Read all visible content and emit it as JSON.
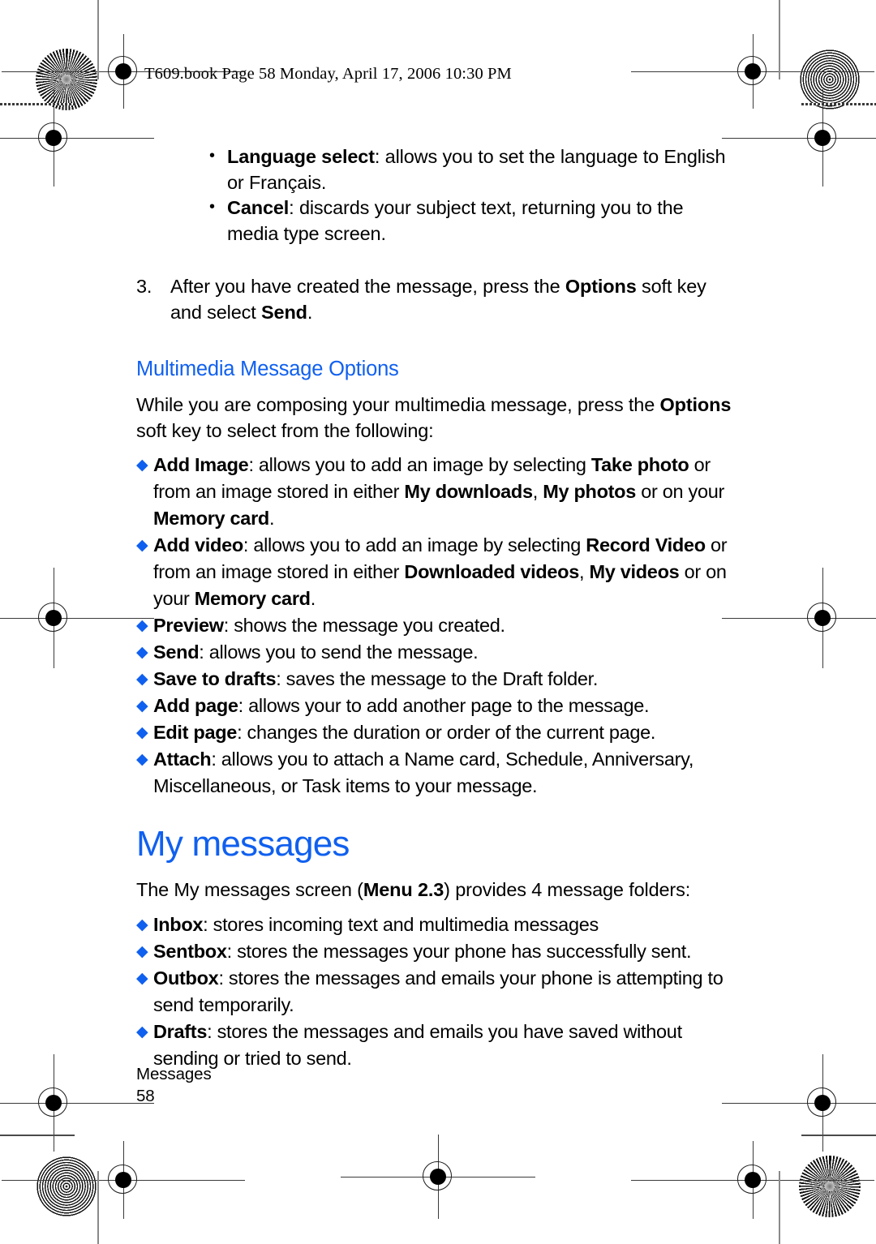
{
  "meta": {
    "accent_color": "#1060ef",
    "text_color": "#000000",
    "page_background": "#ffffff"
  },
  "running_head": "T609.book  Page 58  Monday, April 17, 2006  10:30 PM",
  "subject_options": {
    "items": [
      {
        "term": "Language select",
        "separator": ": ",
        "text": "allows you to set the language to English or Français."
      },
      {
        "term": "Cancel",
        "separator": ": ",
        "text": "discards your subject text, returning you to the media type screen."
      }
    ]
  },
  "step": {
    "number": "3.",
    "part1": "After you have created the message, press the ",
    "bold1": "Options",
    "part2": " soft key and select ",
    "bold2": "Send",
    "part3": "."
  },
  "section_mms": {
    "heading": "Multimedia Message Options",
    "intro_part1": "While you are composing your multimedia message, press the ",
    "intro_bold": "Options",
    "intro_part2": " soft key to select from the following:",
    "options": [
      {
        "term": "Add Image",
        "segments": [
          {
            "text": ": allows you to add an image by selecting ",
            "bold": false
          },
          {
            "text": "Take photo",
            "bold": true
          },
          {
            "text": " or from an image stored in either ",
            "bold": false
          },
          {
            "text": "My downloads",
            "bold": true
          },
          {
            "text": ", ",
            "bold": false
          },
          {
            "text": "My photos",
            "bold": true
          },
          {
            "text": " or on your ",
            "bold": false
          },
          {
            "text": "Memory card",
            "bold": true
          },
          {
            "text": ".",
            "bold": false
          }
        ]
      },
      {
        "term": "Add video",
        "segments": [
          {
            "text": ": allows you to add an image by selecting ",
            "bold": false
          },
          {
            "text": "Record Video",
            "bold": true
          },
          {
            "text": " or from an image stored in either ",
            "bold": false
          },
          {
            "text": "Downloaded videos",
            "bold": true
          },
          {
            "text": ", ",
            "bold": false
          },
          {
            "text": "My videos",
            "bold": true
          },
          {
            "text": " or on your ",
            "bold": false
          },
          {
            "text": "Memory card",
            "bold": true
          },
          {
            "text": ".",
            "bold": false
          }
        ]
      },
      {
        "term": "Preview",
        "segments": [
          {
            "text": ": shows the message you created.",
            "bold": false
          }
        ]
      },
      {
        "term": "Send",
        "segments": [
          {
            "text": ": allows you to send the message.",
            "bold": false
          }
        ]
      },
      {
        "term": "Save to drafts",
        "segments": [
          {
            "text": ": saves the message to the Draft folder.",
            "bold": false
          }
        ]
      },
      {
        "term": "Add page",
        "segments": [
          {
            "text": ": allows your to add another page to the message.",
            "bold": false
          }
        ]
      },
      {
        "term": "Edit page",
        "segments": [
          {
            "text": ": changes the duration or order of the current page.",
            "bold": false
          }
        ]
      },
      {
        "term": "Attach",
        "segments": [
          {
            "text": ": allows you to attach a Name card, Schedule, Anniversary, Miscellaneous, or Task items to your message.",
            "bold": false
          }
        ]
      }
    ]
  },
  "section_my_messages": {
    "title": "My messages",
    "intro_part1": "The My messages screen (",
    "intro_bold": "Menu 2.3",
    "intro_part2": ") provides 4 message folders:",
    "folders": [
      {
        "term": "Inbox",
        "segments": [
          {
            "text": ": stores incoming text and multimedia messages",
            "bold": false
          }
        ]
      },
      {
        "term": "Sentbox",
        "segments": [
          {
            "text": ": stores the messages your phone has successfully sent.",
            "bold": false
          }
        ]
      },
      {
        "term": "Outbox",
        "segments": [
          {
            "text": ": stores the messages and emails your phone is attempting to send temporarily.",
            "bold": false
          }
        ]
      },
      {
        "term": "Drafts",
        "segments": [
          {
            "text": ": stores the messages and emails you have saved without sending or tried to send.",
            "bold": false
          }
        ]
      }
    ]
  },
  "footer": {
    "chapter": "Messages",
    "page_number": "58"
  }
}
